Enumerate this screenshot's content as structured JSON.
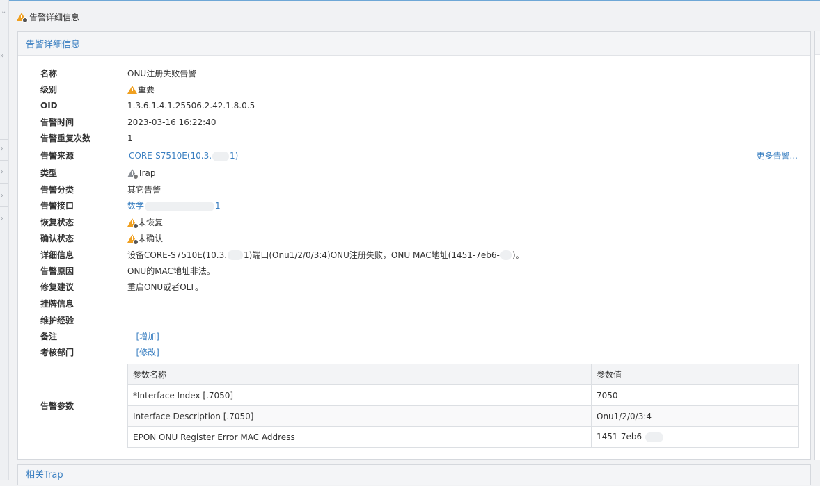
{
  "page": {
    "title": "告警详细信息"
  },
  "panel": {
    "title": "告警详细信息"
  },
  "fields": {
    "name": {
      "label": "名称",
      "value": "ONU注册失败告警"
    },
    "level": {
      "label": "级别",
      "value": "重要"
    },
    "oid": {
      "label": "OID",
      "value": "1.3.6.1.4.1.25506.2.42.1.8.0.5"
    },
    "time": {
      "label": "告警时间",
      "value": "2023-03-16 16:22:40"
    },
    "repeat": {
      "label": "告警重复次数",
      "value": "1"
    },
    "source": {
      "label": "告警来源",
      "value_a": "CORE-S7510E(10.3.",
      "value_b": "1)",
      "more": "更多告警..."
    },
    "type": {
      "label": "类型",
      "value": "Trap"
    },
    "category": {
      "label": "告警分类",
      "value": "其它告警"
    },
    "interface": {
      "label": "告警接口",
      "value_a": "数学",
      "value_b": "1"
    },
    "recovery": {
      "label": "恢复状态",
      "value": "未恢复"
    },
    "confirm": {
      "label": "确认状态",
      "value": "未确认"
    },
    "detail": {
      "label": "详细信息",
      "value_a": "设备CORE-S7510E(10.3.",
      "value_b": "1)端口(Onu1/2/0/3:4)ONU注册失败，ONU MAC地址(1451-7eb6-",
      "value_c": ")。"
    },
    "reason": {
      "label": "告警原因",
      "value": "ONU的MAC地址非法。"
    },
    "suggestion": {
      "label": "修复建议",
      "value": "重启ONU或者OLT。"
    },
    "tag": {
      "label": "挂牌信息",
      "value": ""
    },
    "experience": {
      "label": "维护经验",
      "value": ""
    },
    "remark": {
      "label": "备注",
      "value": "--",
      "action": "[增加]"
    },
    "department": {
      "label": "考核部门",
      "value": "--",
      "action": "[修改]"
    },
    "params": {
      "label": "告警参数"
    }
  },
  "params_table": {
    "headers": [
      "参数名称",
      "参数值"
    ],
    "rows": [
      {
        "name": "*Interface Index [.7050]",
        "value": "7050"
      },
      {
        "name": "Interface Description [.7050]",
        "value": "Onu1/2/0/3:4"
      },
      {
        "name": "EPON ONU Register Error MAC Address",
        "value": "1451-7eb6-"
      }
    ]
  },
  "related": {
    "title": "相关Trap"
  },
  "icons": {
    "warning": "warning-icon",
    "trap": "trap-icon"
  },
  "colors": {
    "accent": "#3a7fc1",
    "warning": "#f0a020"
  }
}
